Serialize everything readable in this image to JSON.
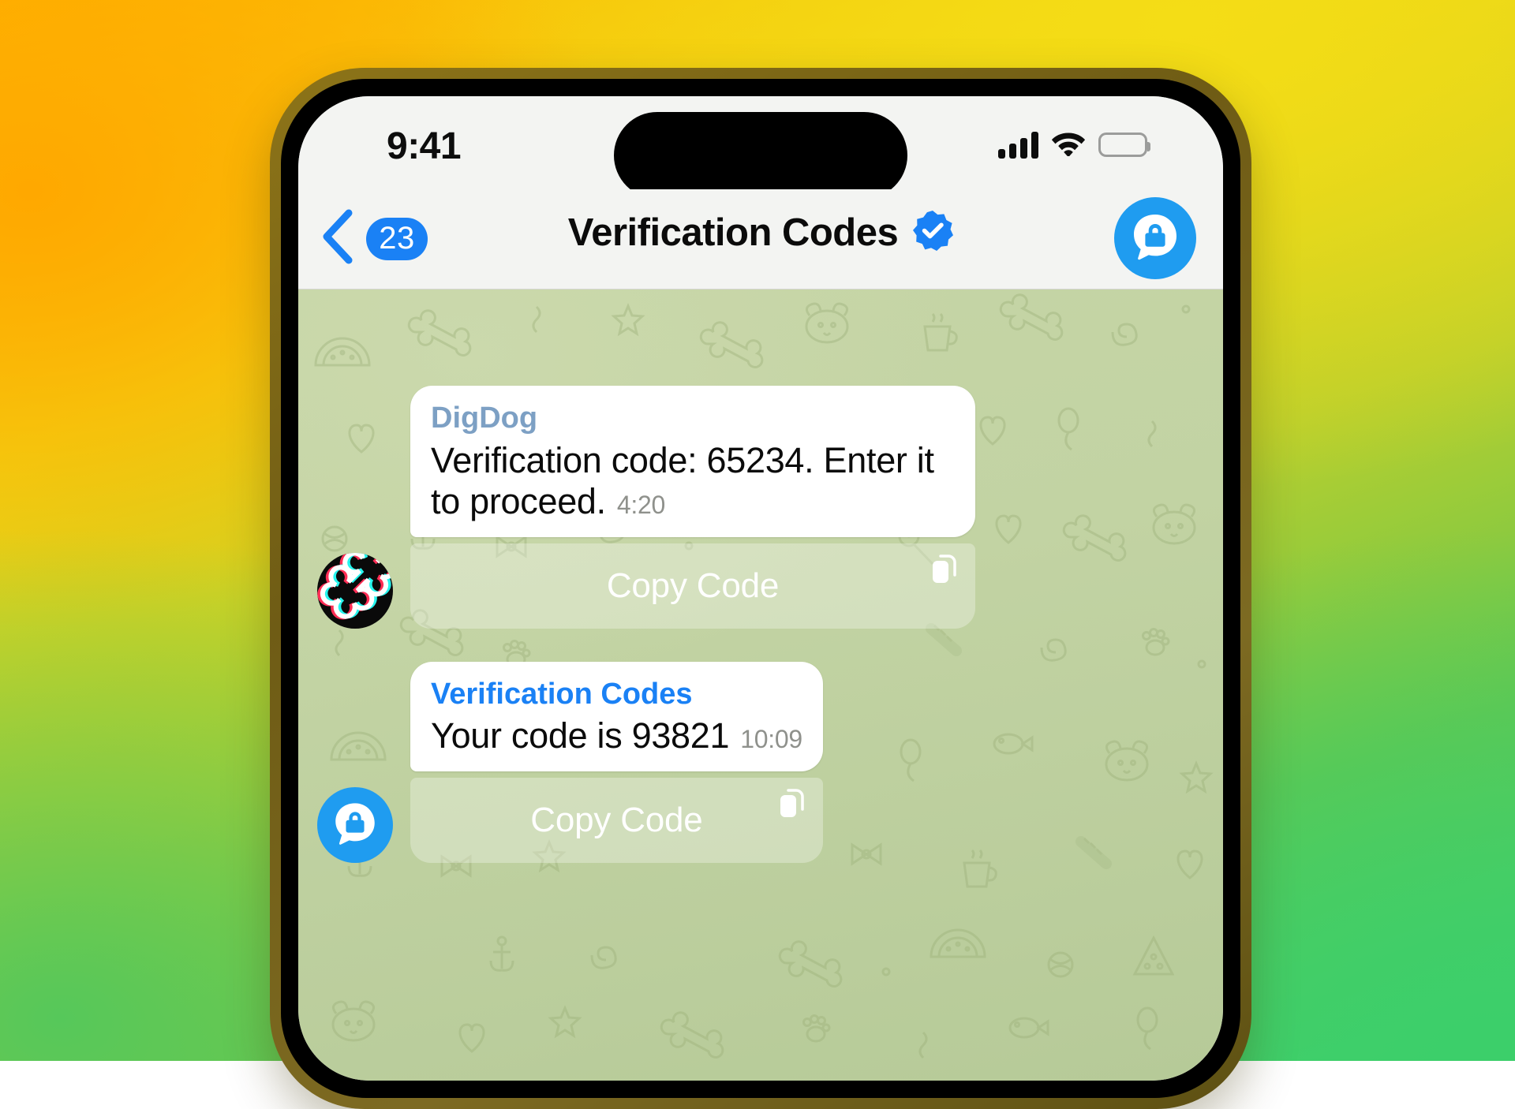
{
  "backdrop": {
    "gradient_from": "#ffb400",
    "gradient_mid": "#f0d614",
    "gradient_to": "#3fd070"
  },
  "device": {
    "frame_color": "#7d6a22",
    "bezel_color": "#000000",
    "screen_bg": "#f3f4f2"
  },
  "status_bar": {
    "time": "9:41",
    "cellular_icon": "cellular-signal-icon",
    "wifi_icon": "wifi-icon",
    "battery_icon": "battery-full-icon",
    "dynamic_island": "dynamic-island"
  },
  "nav_bar": {
    "back_icon": "chevron-left-icon",
    "unread_count": "23",
    "title": "Verification Codes",
    "verified_icon": "verified-badge-icon",
    "avatar_icon": "lock-chat-avatar-icon",
    "accent_color": "#1a81f5",
    "avatar_color": "#1f9cf0"
  },
  "chat": {
    "wallpaper": "telegram-doodle-pattern-green",
    "wallpaper_color": "#c2d3a3",
    "messages": [
      {
        "avatar": "digdog-bone-avatar",
        "avatar_bg": "#0a0a0a",
        "sender": "DigDog",
        "sender_color": "#7da0c4",
        "text": "Verification code: 65234. Enter it to proceed.",
        "code": "65234",
        "time": "4:20",
        "action_label": "Copy Code",
        "action_icon": "copy-icon"
      },
      {
        "avatar": "verification-codes-avatar",
        "avatar_bg": "#1f9cf0",
        "sender": "Verification Codes",
        "sender_color": "#1a81f5",
        "text": "Your code is 93821",
        "code": "93821",
        "time": "10:09",
        "action_label": "Copy Code",
        "action_icon": "copy-icon"
      }
    ]
  }
}
